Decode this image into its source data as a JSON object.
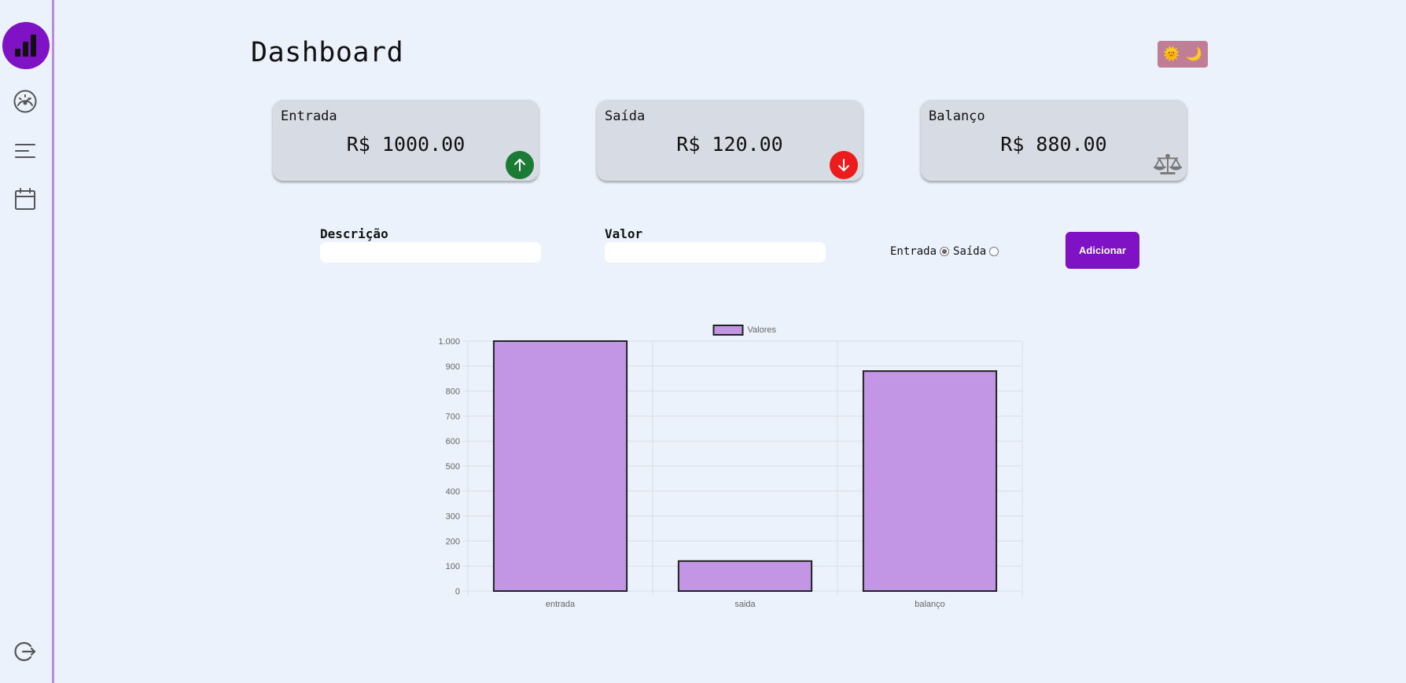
{
  "page": {
    "title": "Dashboard"
  },
  "theme_toggle": {
    "sun": "🌞",
    "moon": "🌙"
  },
  "sidebar": {
    "items": [
      {
        "icon": "bar-chart-icon"
      },
      {
        "icon": "speedometer-icon"
      },
      {
        "icon": "list-icon"
      },
      {
        "icon": "calendar-icon"
      },
      {
        "icon": "logout-icon"
      }
    ],
    "accent": "#7e12c4"
  },
  "cards": [
    {
      "label": "Entrada",
      "value": "R$ 1000.00",
      "icon": "arrow-up-icon",
      "color": "#1b7a34"
    },
    {
      "label": "Saída",
      "value": "R$ 120.00",
      "icon": "arrow-down-icon",
      "color": "#ec1c1c"
    },
    {
      "label": "Balanço",
      "value": "R$ 880.00",
      "icon": "balance-scale-icon",
      "color": "#777777"
    }
  ],
  "form": {
    "description_label": "Descrição",
    "description_value": "",
    "value_label": "Valor",
    "value_value": "",
    "radio_entrada": "Entrada",
    "radio_saida": "Saída",
    "selected_type": "Entrada",
    "add_button": "Adicionar"
  },
  "chart_data": {
    "type": "bar",
    "categories": [
      "entrada",
      "saida",
      "balanço"
    ],
    "series": [
      {
        "name": "Valores",
        "values": [
          1000,
          120,
          880
        ]
      }
    ],
    "yticks": [
      "0",
      "100",
      "200",
      "300",
      "400",
      "500",
      "600",
      "700",
      "800",
      "900",
      "1.000"
    ],
    "ylim": [
      0,
      1000
    ],
    "grid": true,
    "legend": "top-center",
    "bar_color": "#c296e4",
    "bar_border": "#222222"
  }
}
